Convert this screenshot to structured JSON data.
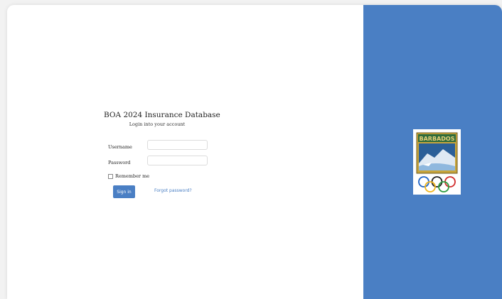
{
  "login": {
    "title": "BOA 2024 Insurance Database",
    "subtitle": "Login into your account",
    "username_label": "Username",
    "username_value": "",
    "password_label": "Password",
    "password_value": "",
    "remember_label": "Remember me",
    "remember_checked": false,
    "signin_label": "Sign in",
    "forgot_label": "Forgot password?"
  },
  "logo": {
    "text": "BARBADOS"
  },
  "colors": {
    "accent": "#4a7fc4",
    "logo_gold": "#c8a53c",
    "logo_green": "#2f6b3a"
  }
}
